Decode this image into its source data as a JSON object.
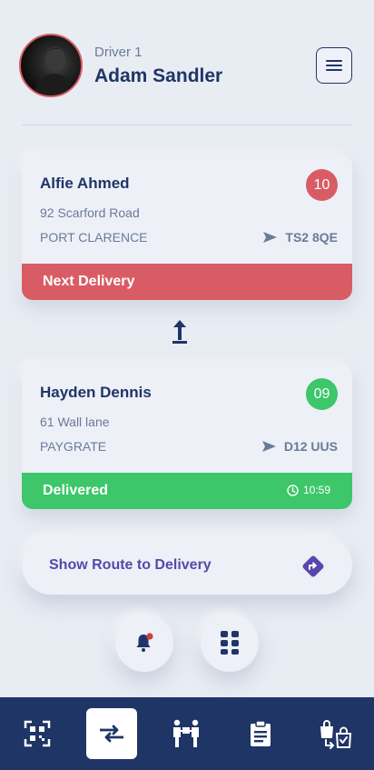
{
  "header": {
    "driver_label": "Driver 1",
    "driver_name": "Adam Sandler"
  },
  "deliveries": [
    {
      "name": "Alfie Ahmed",
      "address": "92 Scarford Road",
      "city": "PORT CLARENCE",
      "postcode": "TS2 8QE",
      "number": "10",
      "status": "Next Delivery",
      "time": "",
      "status_color": "#d95b63"
    },
    {
      "name": "Hayden Dennis",
      "address": "61 Wall lane",
      "city": "PAYGRATE",
      "postcode": "D12 UUS",
      "number": "09",
      "status": "Delivered",
      "time": "10:59",
      "status_color": "#3ec66a"
    }
  ],
  "route_button": {
    "label": "Show Route to Delivery"
  },
  "icons": {
    "menu": "hamburger-icon",
    "send": "send-arrow-icon",
    "clock": "clock-icon",
    "move": "arrow-up-icon",
    "route": "directions-icon",
    "notifications": "bell-icon",
    "apps": "grid-icon"
  },
  "bottom_nav": [
    {
      "icon": "qr-scan-icon",
      "active": false
    },
    {
      "icon": "swap-icon",
      "active": true
    },
    {
      "icon": "handover-icon",
      "active": false
    },
    {
      "icon": "clipboard-icon",
      "active": false
    },
    {
      "icon": "bag-transfer-icon",
      "active": false
    }
  ],
  "colors": {
    "primary": "#1f3566",
    "accent": "#5a47ab",
    "danger": "#d95b63",
    "success": "#3ec66a",
    "background": "#e8ecf3"
  }
}
